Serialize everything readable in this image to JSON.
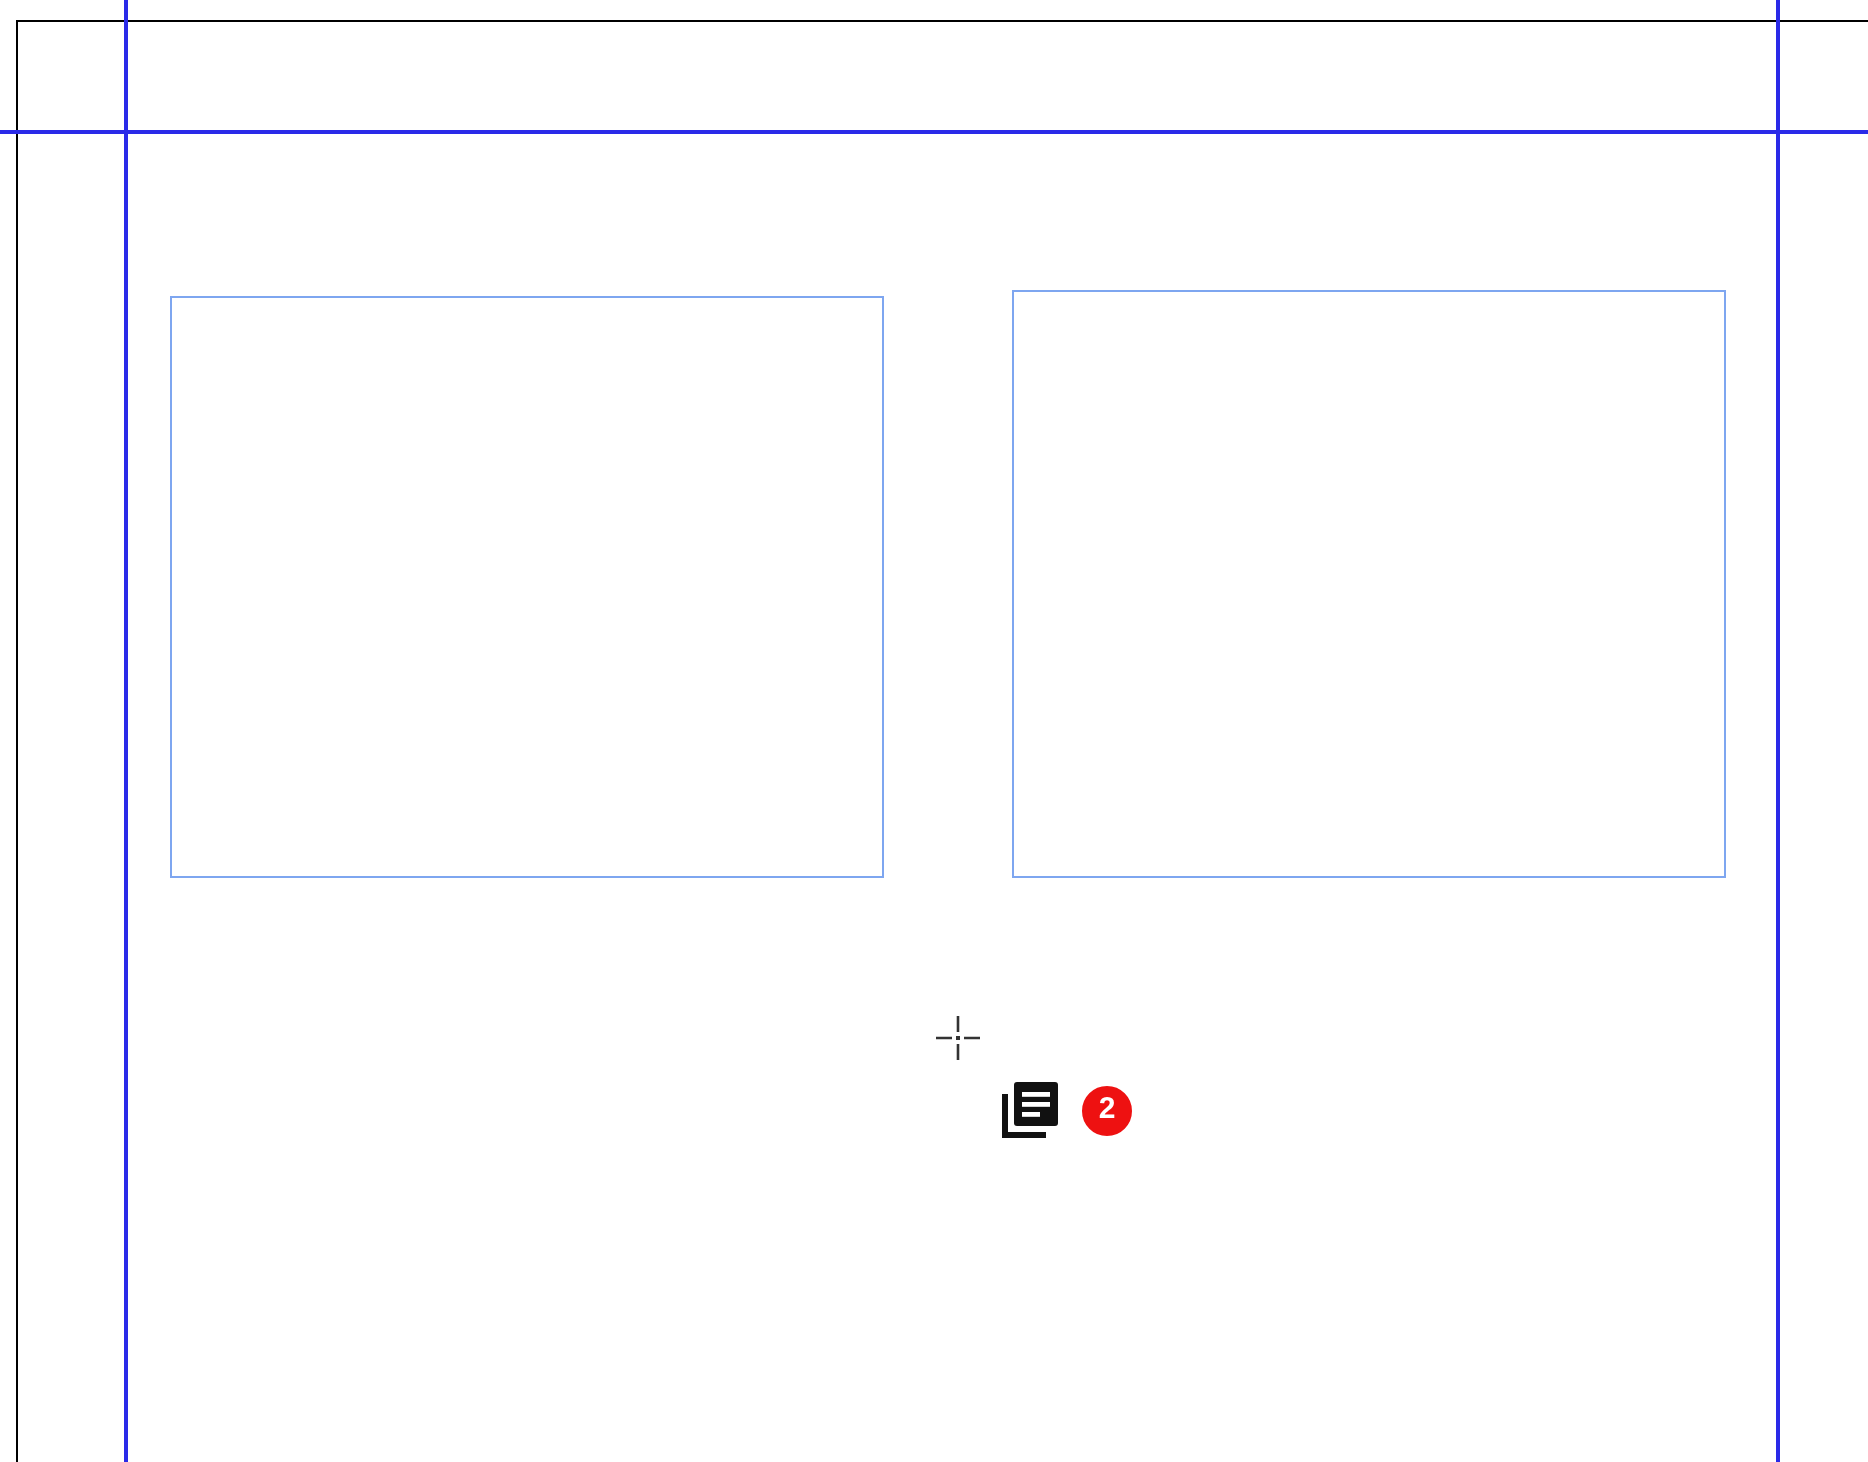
{
  "drag_indicator": {
    "count": "2"
  }
}
